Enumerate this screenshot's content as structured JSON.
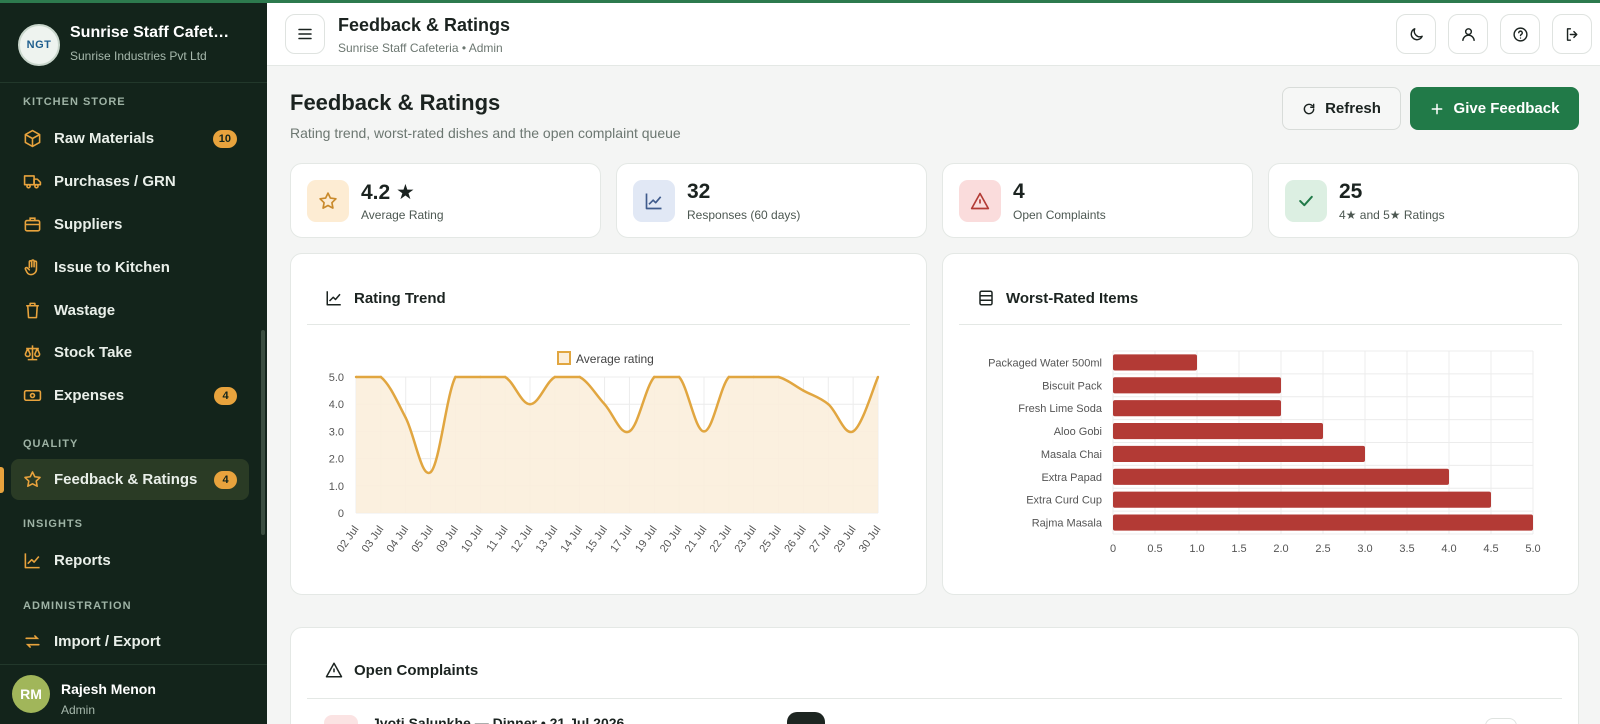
{
  "app": {
    "name": "Sunrise Staff Cafet…",
    "company": "Sunrise Industries Pvt Ltd",
    "logo_text": "NGT"
  },
  "sidebar": {
    "sections": [
      {
        "title": "KITCHEN STORE"
      },
      {
        "title": "QUALITY"
      },
      {
        "title": "INSIGHTS"
      },
      {
        "title": "ADMINISTRATION"
      }
    ],
    "items": [
      {
        "label": "Raw Materials",
        "badge": "10",
        "icon": "box-icon"
      },
      {
        "label": "Purchases / GRN",
        "badge": "",
        "icon": "truck-icon"
      },
      {
        "label": "Suppliers",
        "badge": "",
        "icon": "briefcase-icon"
      },
      {
        "label": "Issue to Kitchen",
        "badge": "",
        "icon": "hand-icon"
      },
      {
        "label": "Wastage",
        "badge": "",
        "icon": "trash-icon"
      },
      {
        "label": "Stock Take",
        "badge": "",
        "icon": "scale-icon"
      },
      {
        "label": "Expenses",
        "badge": "4",
        "icon": "banknote-icon"
      },
      {
        "label": "Feedback & Ratings",
        "badge": "4",
        "icon": "star-icon"
      },
      {
        "label": "Reports",
        "badge": "",
        "icon": "chart-line-icon"
      },
      {
        "label": "Import / Export",
        "badge": "",
        "icon": "arrows-swap-icon"
      }
    ],
    "user": {
      "initials": "RM",
      "name": "Rajesh Menon",
      "role": "Admin"
    }
  },
  "header": {
    "title": "Feedback & Ratings",
    "subtitle": "Sunrise Staff Cafeteria • Admin"
  },
  "page": {
    "title": "Feedback & Ratings",
    "subtitle": "Rating trend, worst-rated dishes and the open complaint queue",
    "refresh_label": "Refresh",
    "give_feedback_label": "Give Feedback"
  },
  "stats": [
    {
      "value": "4.2 ★",
      "label": "Average Rating",
      "icon": "star-icon"
    },
    {
      "value": "32",
      "label": "Responses (60 days)",
      "icon": "chart-line-icon"
    },
    {
      "value": "4",
      "label": "Open Complaints",
      "icon": "warning-icon"
    },
    {
      "value": "25",
      "label": "4★ and 5★ Ratings",
      "icon": "check-icon"
    }
  ],
  "cards": {
    "trend_title": "Rating Trend",
    "worst_title": "Worst-Rated Items",
    "complaints_title": "Open Complaints"
  },
  "complaints": [
    {
      "name": "Jyoti Salunkhe — Dinner • 21 Jul 2026"
    }
  ],
  "colors": {
    "sidebar_bg": "#13241b",
    "accent_green": "#217a48",
    "badge_amber": "#e8a33d",
    "trend_line": "#e1a640",
    "bar_red": "#b33a35"
  },
  "chart_data": [
    {
      "type": "line",
      "legend": "Average rating",
      "legend_position": "top",
      "x": [
        "02 Jul",
        "03 Jul",
        "04 Jul",
        "05 Jul",
        "09 Jul",
        "10 Jul",
        "11 Jul",
        "12 Jul",
        "13 Jul",
        "14 Jul",
        "15 Jul",
        "17 Jul",
        "19 Jul",
        "20 Jul",
        "21 Jul",
        "22 Jul",
        "23 Jul",
        "25 Jul",
        "26 Jul",
        "27 Jul",
        "29 Jul",
        "30 Jul"
      ],
      "values": [
        5,
        5,
        3.5,
        1.5,
        5,
        5,
        5,
        4,
        5,
        5,
        4,
        3,
        5,
        5,
        3,
        5,
        5,
        5,
        4.5,
        4,
        3,
        5
      ],
      "yticks": [
        "0",
        "1.0",
        "2.0",
        "3.0",
        "4.0",
        "5.0"
      ],
      "ylim": [
        0,
        5
      ],
      "grid": true
    },
    {
      "type": "bar",
      "orientation": "horizontal",
      "categories": [
        "Packaged Water 500ml",
        "Biscuit Pack",
        "Fresh Lime Soda",
        "Aloo Gobi",
        "Masala Chai",
        "Extra Papad",
        "Extra Curd Cup",
        "Rajma Masala"
      ],
      "values": [
        1.0,
        2.0,
        2.0,
        2.5,
        3.0,
        4.0,
        4.5,
        5.0
      ],
      "xticks": [
        "0",
        "0.5",
        "1.0",
        "1.5",
        "2.0",
        "2.5",
        "3.0",
        "3.5",
        "4.0",
        "4.5",
        "5.0"
      ],
      "xlim": [
        0,
        5
      ],
      "grid": true
    }
  ]
}
